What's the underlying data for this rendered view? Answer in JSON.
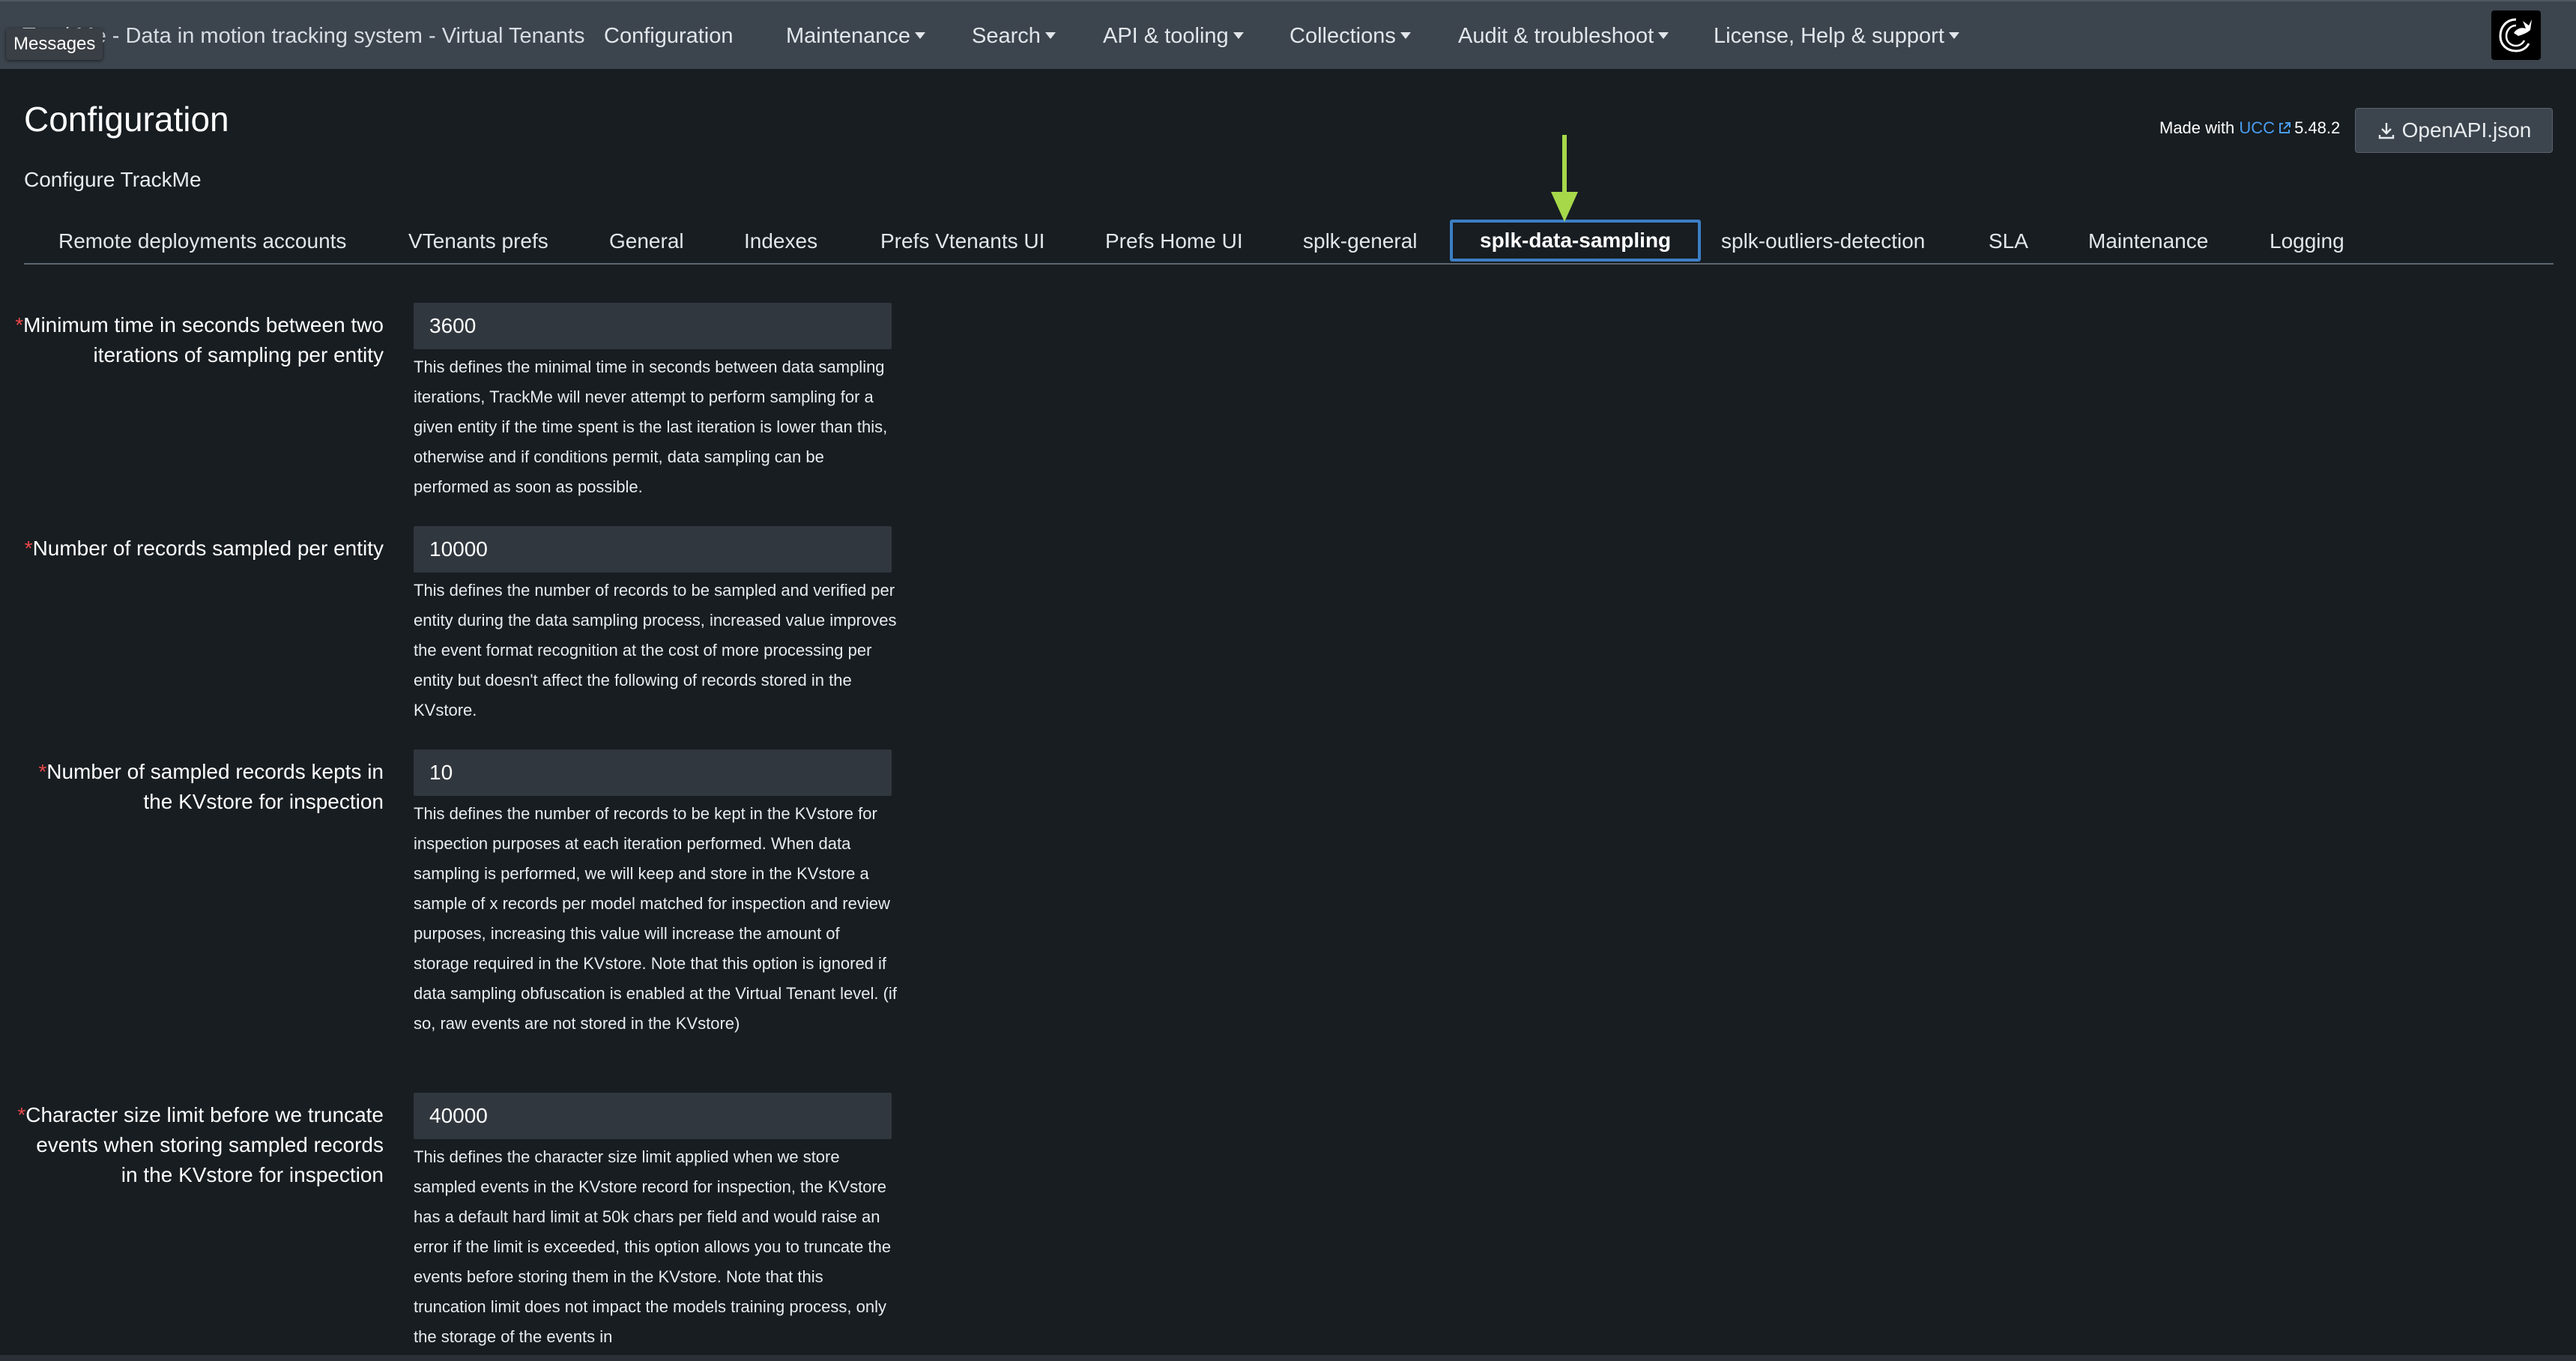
{
  "topnav": {
    "app_title": "TrackMe - Data in motion tracking system - Virtual Tenants",
    "messages_tooltip": "Messages",
    "items": [
      {
        "label": "Configuration",
        "dropdown": false
      },
      {
        "label": "Maintenance",
        "dropdown": true
      },
      {
        "label": "Search",
        "dropdown": true
      },
      {
        "label": "API & tooling",
        "dropdown": true
      },
      {
        "label": "Collections",
        "dropdown": true
      },
      {
        "label": "Audit & troubleshoot",
        "dropdown": true
      },
      {
        "label": "License, Help & support",
        "dropdown": true
      }
    ],
    "logo_icon": "trackme-logo-icon"
  },
  "header": {
    "title": "Configuration",
    "subtitle": "Configure TrackMe",
    "made_with_prefix": "Made with",
    "made_with_link": "UCC",
    "version": "5.48.2",
    "openapi_button": "OpenAPI.json"
  },
  "tabs": [
    "Remote deployments accounts",
    "VTenants prefs",
    "General",
    "Indexes",
    "Prefs Vtenants UI",
    "Prefs Home UI",
    "splk-general",
    "splk-data-sampling",
    "splk-outliers-detection",
    "SLA",
    "Maintenance",
    "Logging"
  ],
  "active_tab": "splk-data-sampling",
  "colors": {
    "accent": "#3c7ec4",
    "arrow": "#a6d84a",
    "required": "#e8474a",
    "link": "#4a9df0"
  },
  "fields": [
    {
      "label": "Minimum time in seconds between two iterations of sampling per entity",
      "value": "3600",
      "help": "This defines the minimal time in seconds between data sampling iterations, TrackMe will never attempt to perform sampling for a given entity if the time spent is the last iteration is lower than this, otherwise and if conditions permit, data sampling can be performed as soon as possible."
    },
    {
      "label": "Number of records sampled per entity",
      "value": "10000",
      "help": "This defines the number of records to be sampled and verified per entity during the data sampling process, increased value improves the event format recognition at the cost of more processing per entity but doesn't affect the following of records stored in the KVstore."
    },
    {
      "label": "Number of sampled records kepts in the KVstore for inspection",
      "value": "10",
      "help": "This defines the number of records to be kept in the KVstore for inspection purposes at each iteration performed. When data sampling is performed, we will keep and store in the KVstore a sample of x records per model matched for inspection and review purposes, increasing this value will increase the amount of storage required in the KVstore. Note that this option is ignored if data sampling obfuscation is enabled at the Virtual Tenant level. (if so, raw events are not stored in the KVstore)"
    },
    {
      "label": "Character size limit before we truncate events when storing sampled records in the KVstore for inspection",
      "value": "40000",
      "help": "This defines the character size limit applied when we store sampled events in the KVstore record for inspection, the KVstore has a default hard limit at 50k chars per field and would raise an error if the limit is exceeded, this option allows you to truncate the events before storing them in the KVstore. Note that this truncation limit does not impact the models training process, only the storage of the events in"
    }
  ]
}
